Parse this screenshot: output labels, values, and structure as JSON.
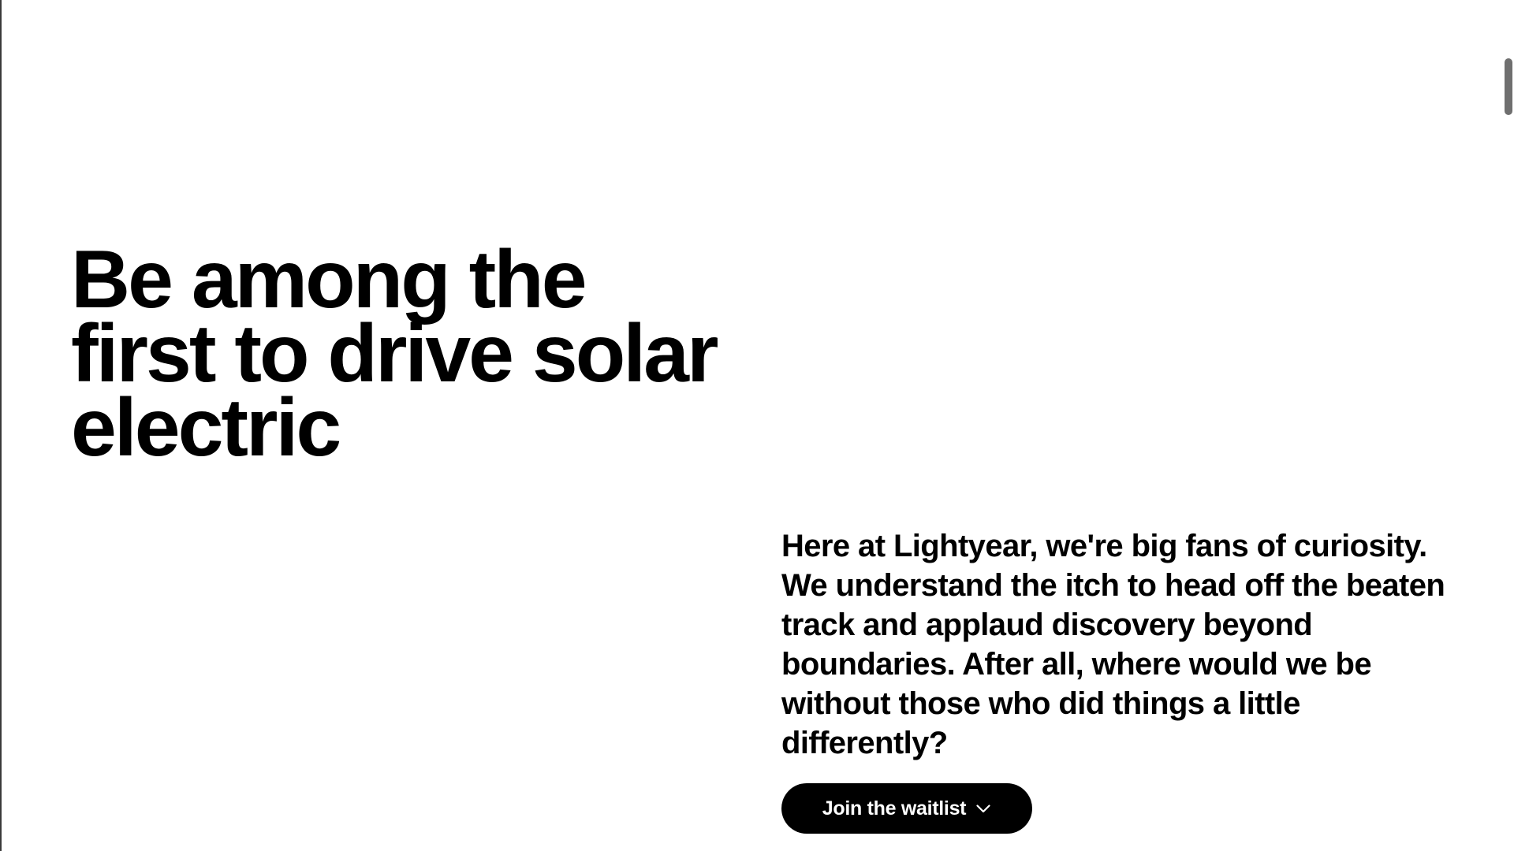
{
  "hero": {
    "headline_lines": [
      "Be among the",
      "first to drive solar",
      "electric"
    ],
    "intro": "Here at Lightyear, we're big fans of curiosity. We understand the itch to head off the beaten track and applaud discovery beyond boundaries. After all, where would we be without those who did things a little differently?",
    "cta": {
      "label": "Join the waitlist",
      "icon": "chevron-down-icon"
    }
  },
  "colors": {
    "background": "#ffffff",
    "text": "#000000",
    "button_bg": "#000000",
    "button_text": "#ffffff",
    "scrollbar_thumb": "#6f6f6f"
  }
}
